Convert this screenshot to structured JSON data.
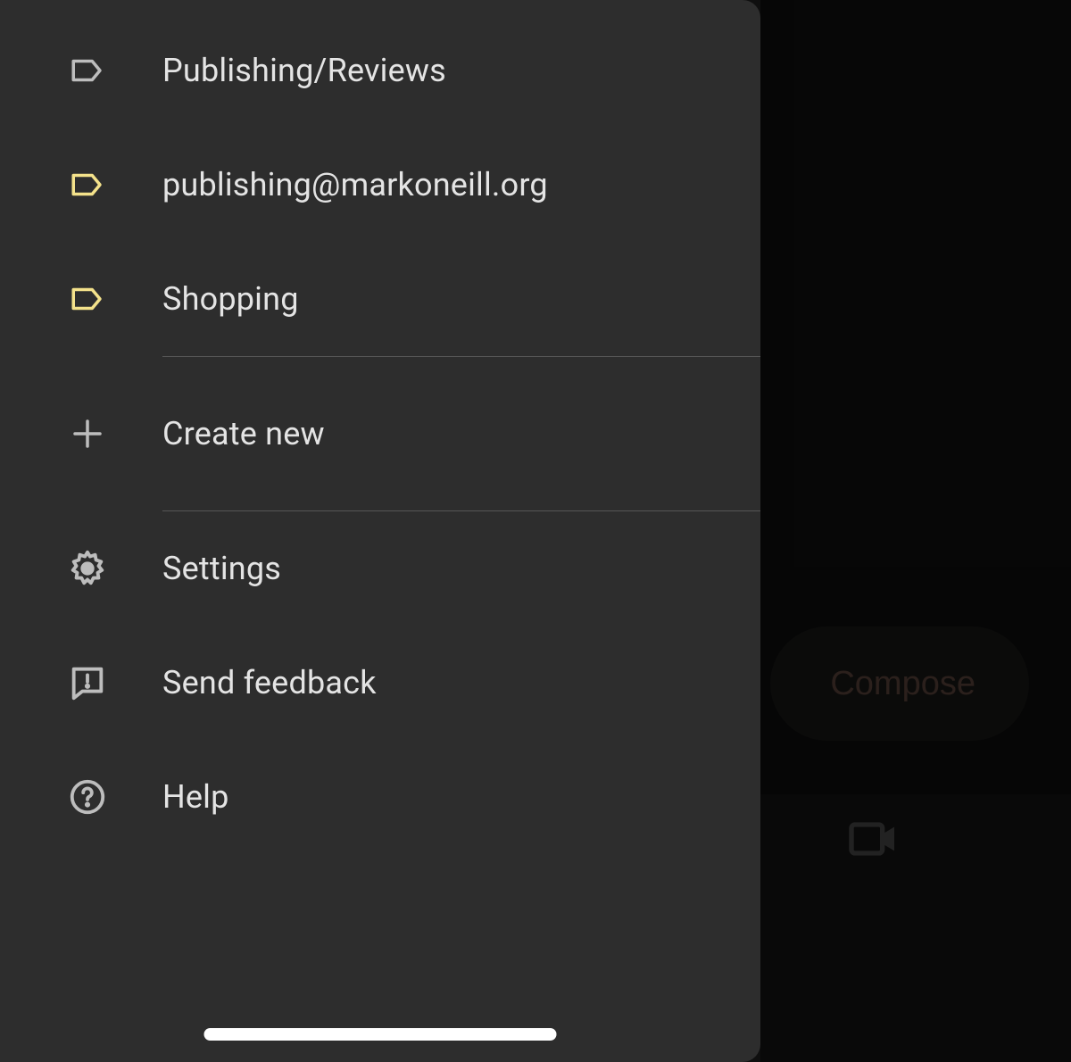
{
  "labels": [
    {
      "id": "publishing-reviews",
      "text": "Publishing/Reviews",
      "icon": "label",
      "color": "#bdbdbd"
    },
    {
      "id": "publishing-email",
      "text": "publishing@markoneill.org",
      "icon": "label",
      "color": "#f4e28b"
    },
    {
      "id": "shopping",
      "text": "Shopping",
      "icon": "label",
      "color": "#f4e28b"
    }
  ],
  "create_new": "Create new",
  "footer": {
    "settings": "Settings",
    "send_feedback": "Send feedback",
    "help": "Help"
  },
  "compose": "Compose"
}
